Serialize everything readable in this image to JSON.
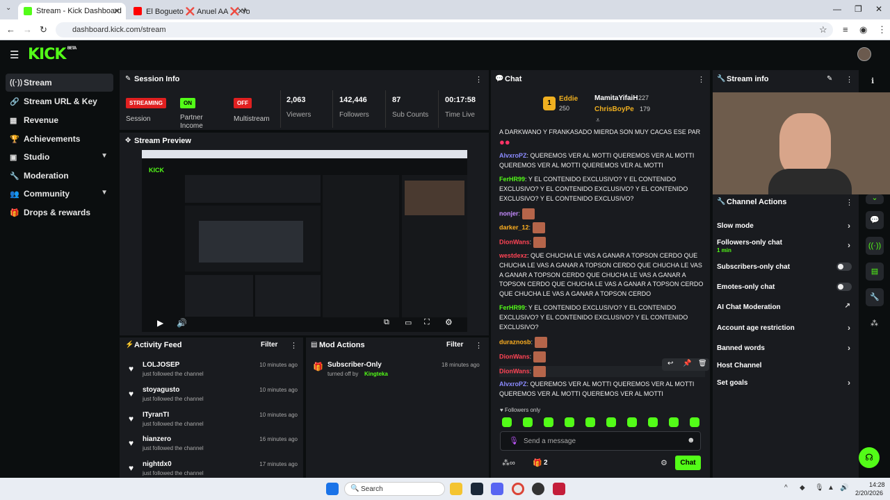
{
  "browser": {
    "tabs": [
      {
        "title": "Stream - Kick Dashboard",
        "active": true
      },
      {
        "title": "El Bogueto ❌ Anuel AA ❌ Yo",
        "active": false
      }
    ],
    "url": "dashboard.kick.com/stream"
  },
  "brand": {
    "logo": "KICK",
    "beta": "BETA",
    "accent": "#53fc18"
  },
  "sidebar": {
    "items": [
      {
        "label": "Stream",
        "icon": "stream-icon"
      },
      {
        "label": "Stream URL & Key",
        "icon": "link-icon"
      },
      {
        "label": "Revenue",
        "icon": "revenue-icon"
      },
      {
        "label": "Achievements",
        "icon": "trophy-icon"
      },
      {
        "label": "Studio",
        "icon": "studio-icon"
      },
      {
        "label": "Moderation",
        "icon": "wrench-icon"
      },
      {
        "label": "Community",
        "icon": "community-icon"
      },
      {
        "label": "Drops & rewards",
        "icon": "gift-icon"
      }
    ]
  },
  "session": {
    "title": "Session Info",
    "stats": [
      {
        "badge": "STREAMING",
        "label": "Session"
      },
      {
        "badge": "ON",
        "label": "Partner Income"
      },
      {
        "badge": "OFF",
        "label": "Multistream"
      },
      {
        "value": "2,063",
        "label": "Viewers"
      },
      {
        "value": "142,446",
        "label": "Followers"
      },
      {
        "value": "87",
        "label": "Sub Counts"
      },
      {
        "value": "00:17:58",
        "label": "Time Live"
      }
    ]
  },
  "preview": {
    "title": "Stream Preview"
  },
  "activity": {
    "title": "Activity Feed",
    "filter": "Filter",
    "items": [
      {
        "name": "LOLJOSEP",
        "action": "just followed the channel",
        "time": "10 minutes ago"
      },
      {
        "name": "stoyagusto",
        "action": "just followed the channel",
        "time": "10 minutes ago"
      },
      {
        "name": "ITyranTI",
        "action": "just followed the channel",
        "time": "10 minutes ago"
      },
      {
        "name": "hianzero",
        "action": "just followed the channel",
        "time": "16 minutes ago"
      },
      {
        "name": "nightdx0",
        "action": "just followed the channel",
        "time": "17 minutes ago"
      }
    ]
  },
  "mod_actions": {
    "title": "Mod Actions",
    "filter": "Filter",
    "items": [
      {
        "title": "Subscriber-Only",
        "detail": "turned off by",
        "by": "Kingteka",
        "time": "18 minutes ago"
      }
    ]
  },
  "chat": {
    "title": "Chat",
    "leaderboard": [
      {
        "rank": "1",
        "name": "Eddie",
        "score": "250"
      },
      {
        "name": "MamitaYifaiH",
        "score": "227"
      },
      {
        "name": "ChrisBoyPe",
        "score": "179"
      }
    ],
    "messages": [
      {
        "user": "",
        "text": "A DARKWANO Y FRANKASADO MIERDA SON MUY CACAS ESE PAR"
      },
      {
        "user": "AlvxroPZ",
        "color": "#8b8bff",
        "text": "QUEREMOS VER AL MOTTI QUEREMOS VER AL MOTTI QUEREMOS VER AL MOTTI QUEREMOS VER AL MOTTI"
      },
      {
        "user": "FerHR99",
        "color": "#53fc18",
        "text": "Y EL CONTENIDO EXCLUSIVO? Y EL CONTENIDO EXCLUSIVO? Y EL CONTENIDO EXCLUSIVO? Y EL CONTENIDO EXCLUSIVO? Y EL CONTENIDO EXCLUSIVO?"
      },
      {
        "user": "nonjer",
        "color": "#c58bff",
        "text": ""
      },
      {
        "user": "darker_12",
        "color": "#ffb020",
        "text": ""
      },
      {
        "user": "DionWans",
        "color": "#ff4455",
        "text": ""
      },
      {
        "user": "westdexz",
        "color": "#ff4455",
        "text": "QUE CHUCHA LE VAS A GANAR A TOPSON CERDO QUE CHUCHA LE VAS A GANAR A TOPSON CERDO QUE CHUCHA LE VAS A GANAR A TOPSON CERDO QUE CHUCHA LE VAS A GANAR A TOPSON CERDO QUE CHUCHA LE VAS A GANAR A TOPSON CERDO QUE CHUCHA LE VAS A GANAR A TOPSON CERDO"
      },
      {
        "user": "FerHR99",
        "color": "#53fc18",
        "text": "Y EL CONTENIDO EXCLUSIVO? Y EL CONTENIDO EXCLUSIVO? Y EL CONTENIDO EXCLUSIVO? Y EL CONTENIDO EXCLUSIVO?"
      },
      {
        "user": "duraznosb",
        "color": "#ffb020",
        "text": ""
      },
      {
        "user": "DionWans",
        "color": "#ff4455",
        "text": ""
      },
      {
        "user": "DionWans",
        "color": "#ff4455",
        "text": ""
      },
      {
        "user": "AlvxroPZ",
        "color": "#8b8bff",
        "text": "QUEREMOS VER AL MOTTI QUEREMOS VER AL MOTTI QUEREMOS VER AL MOTTI QUEREMOS VER AL MOTTI"
      }
    ],
    "followers_only": "Followers only",
    "placeholder": "Send a message",
    "gift_count": "2",
    "send_label": "Chat"
  },
  "stream_info": {
    "title": "Stream info"
  },
  "channel_actions": {
    "title": "Channel Actions",
    "items": [
      {
        "label": "Slow mode",
        "control": "arrow"
      },
      {
        "label": "Followers-only chat",
        "sub": "1 min",
        "control": "arrow"
      },
      {
        "label": "Subscribers-only chat",
        "control": "toggle"
      },
      {
        "label": "Emotes-only chat",
        "control": "toggle"
      },
      {
        "label": "AI Chat Moderation",
        "control": "external"
      },
      {
        "label": "Account age restriction",
        "control": "arrow"
      },
      {
        "label": "Banned words",
        "control": "arrow"
      },
      {
        "label": "Host Channel",
        "control": "none"
      },
      {
        "label": "Set goals",
        "control": "arrow"
      }
    ]
  },
  "taskbar": {
    "search": "Search",
    "time": "14:28",
    "date": "2/20/2026"
  }
}
